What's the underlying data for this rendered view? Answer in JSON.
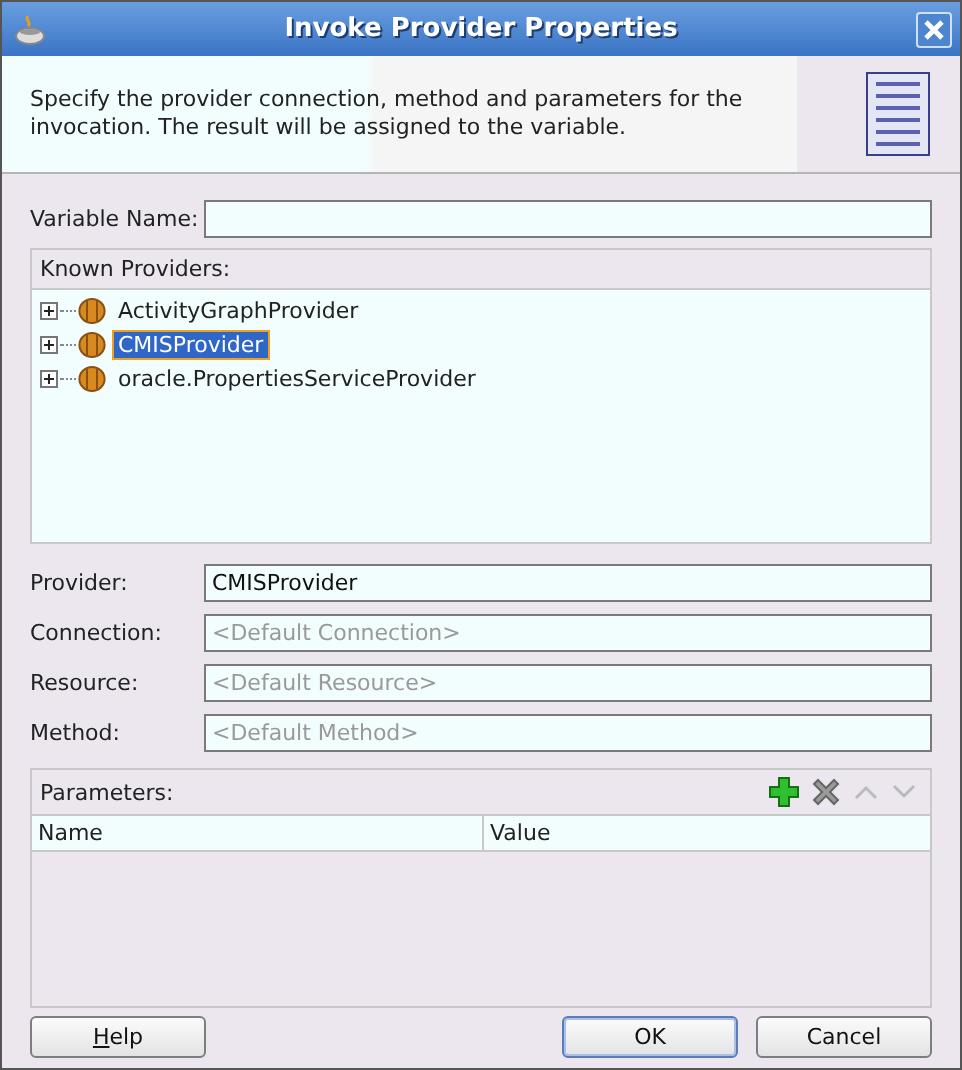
{
  "window": {
    "title": "Invoke Provider Properties"
  },
  "description": "Specify the provider connection, method and parameters for the invocation. The result will be assigned to the variable.",
  "variable_name": {
    "label": "Variable Name:"
  },
  "known_providers": {
    "label": "Known Providers:",
    "items": [
      {
        "label": "ActivityGraphProvider",
        "expanded": false,
        "selected": false
      },
      {
        "label": "CMISProvider",
        "expanded": false,
        "selected": true
      },
      {
        "label": "oracle.PropertiesServiceProvider",
        "expanded": false,
        "selected": false
      }
    ]
  },
  "fields": [
    {
      "label": "Provider:",
      "value": "CMISProvider"
    },
    {
      "label": "Connection:",
      "placeholder": "<Default Connection>"
    },
    {
      "label": "Resource:",
      "placeholder": "<Default Resource>"
    },
    {
      "label": "Method:",
      "placeholder": "<Default Method>"
    }
  ],
  "parameters": {
    "label": "Parameters:",
    "tools": [
      {
        "kind": "add",
        "disabled": false
      },
      {
        "kind": "delete",
        "disabled": false
      },
      {
        "kind": "up",
        "disabled": true
      },
      {
        "kind": "down",
        "disabled": true
      }
    ],
    "columns": [
      "Name",
      "Value"
    ]
  },
  "buttons": [
    {
      "label": "Help",
      "underline_first": true,
      "default": false
    },
    {
      "label": "OK",
      "underline_first": false,
      "default": true
    },
    {
      "label": "Cancel",
      "underline_first": false,
      "default": false
    }
  ]
}
